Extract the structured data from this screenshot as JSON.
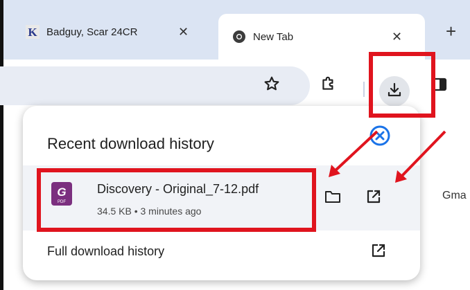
{
  "tabs": [
    {
      "title": "Badguy, Scar 24CR",
      "close": "✕",
      "active": false
    },
    {
      "title": "New Tab",
      "close": "✕",
      "active": true
    }
  ],
  "new_tab_label": "+",
  "download_panel": {
    "header": "Recent download history",
    "file": {
      "name": "Discovery - Original_7-12.pdf",
      "meta": "34.5 KB • 3 minutes ago",
      "icon_label": "PDF"
    },
    "full_history": "Full download history"
  },
  "page_right_text": "Gma",
  "colors": {
    "highlight": "#e0141e",
    "tabstrip": "#dbe4f3",
    "close_circle": "#1a73e8",
    "pdf_icon": "#7b2f7f"
  },
  "icons": {
    "bookmark": "star-icon",
    "extensions": "puzzle-icon",
    "downloads": "download-icon",
    "side_panel": "side-panel-icon",
    "folder": "folder-icon",
    "open": "open-external-icon"
  }
}
